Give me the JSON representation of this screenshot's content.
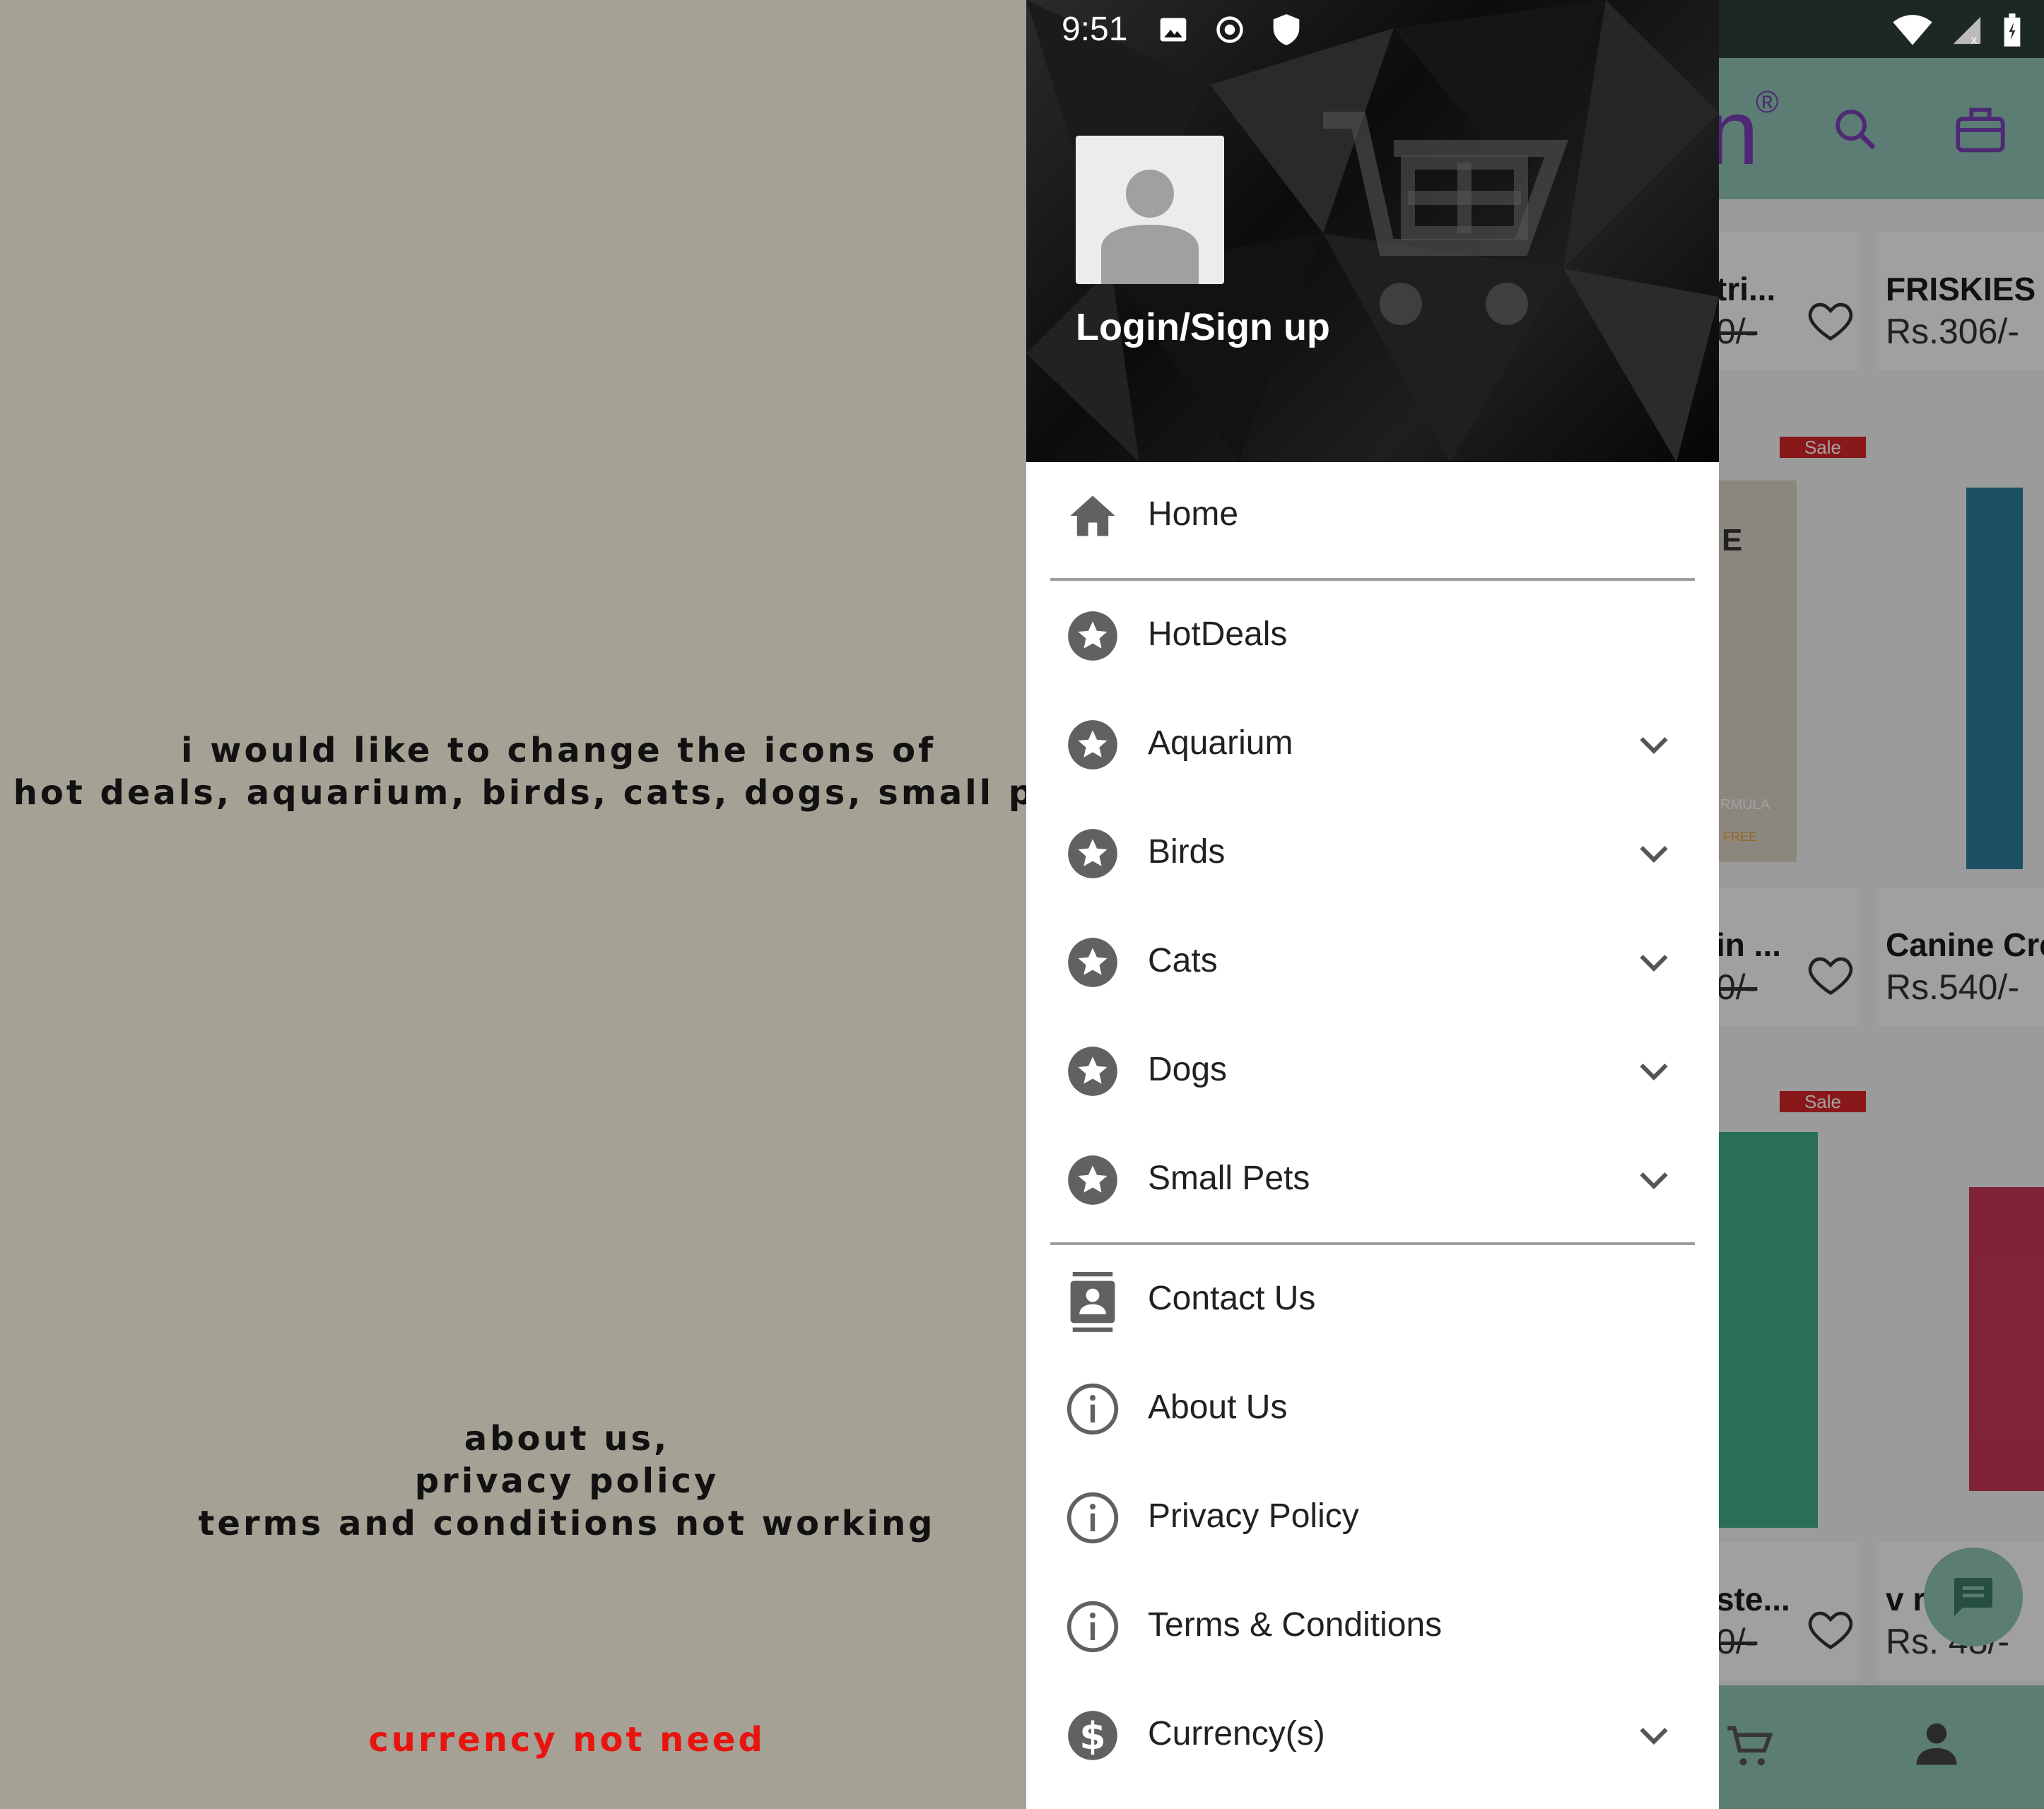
{
  "annotations": {
    "icons_note": [
      "i would like to change the icons of",
      "hot deals, aquarium, birds, cats, dogs, small pets"
    ],
    "links_note": [
      "about us,",
      "privacy policy",
      "terms and conditions not working"
    ],
    "currency_note": "currency not need"
  },
  "status_bar": {
    "time": "9:51"
  },
  "drawer": {
    "login_label": "Login/Sign up",
    "home": "Home",
    "hot_deals": "HotDeals",
    "aquarium": "Aquarium",
    "birds": "Birds",
    "cats": "Cats",
    "dogs": "Dogs",
    "small_pets": "Small Pets",
    "contact_us": "Contact Us",
    "about_us": "About Us",
    "privacy_policy": "Privacy Policy",
    "terms": "Terms & Conditions",
    "currency": "Currency(s)"
  },
  "background_app": {
    "logo_fragment": "n",
    "products": [
      {
        "name": "tri...",
        "price": "0/-"
      },
      {
        "name": "FRISKIES I",
        "price": "Rs.306/-"
      },
      {
        "name": "in ...",
        "price": "0/-"
      },
      {
        "name": "Canine Cre",
        "price": "Rs.540/-"
      },
      {
        "name": "ste...",
        "price": "0/-"
      },
      {
        "name": "v     rui",
        "price": "Rs.   48/-"
      }
    ],
    "sale_label": "Sale",
    "box_text": [
      "E",
      "RMULA",
      "FREE"
    ]
  },
  "colors": {
    "annotation_bg": "#a5a195",
    "annotation_red": "#e8140f",
    "toolbar": "#8fc4b4",
    "drawer_bg": "#ffffff",
    "icon_gray": "#616161"
  },
  "icons": [
    "image-icon",
    "radio-icon",
    "shield-icon",
    "wifi-icon",
    "signal-icon",
    "battery-icon",
    "home-icon",
    "star-icon",
    "chevron-down-icon",
    "contact-icon",
    "info-icon",
    "dollar-icon",
    "heart-icon",
    "search-icon",
    "briefcase-icon",
    "cart-icon",
    "chat-icon",
    "account-icon"
  ]
}
